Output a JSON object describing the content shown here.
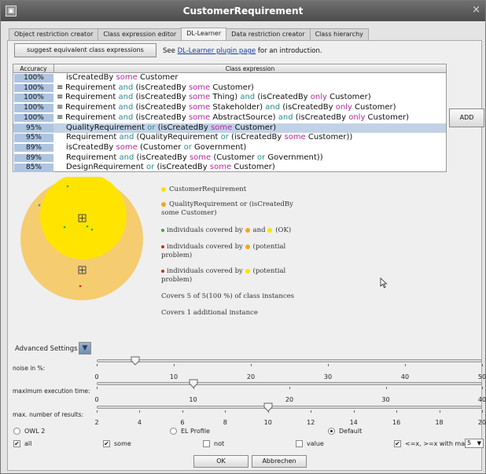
{
  "window": {
    "title": "CustomerRequirement",
    "close_glyph": "×"
  },
  "tabs": [
    {
      "label": "Object restriction creator"
    },
    {
      "label": "Class expression editor"
    },
    {
      "label": "DL-Learner"
    },
    {
      "label": "Data restriction creator"
    },
    {
      "label": "Class hierarchy"
    }
  ],
  "active_tab": "DL-Learner",
  "toolbar": {
    "suggest_label": "suggest equivalent class expressions",
    "intro_prefix": "See ",
    "intro_link": "DL-Learner plugin page",
    "intro_suffix": " for an introduction."
  },
  "table": {
    "headers": {
      "accuracy": "Accuracy",
      "expression": "Class expression"
    },
    "rows": [
      {
        "accuracy": "100%",
        "equivalent": false,
        "expr": [
          [
            "isCreatedBy ",
            ""
          ],
          [
            "some",
            "some"
          ],
          [
            " Customer",
            ""
          ]
        ]
      },
      {
        "accuracy": "100%",
        "equivalent": true,
        "expr": [
          [
            "Requirement ",
            ""
          ],
          [
            "and",
            "and"
          ],
          [
            " (isCreatedBy ",
            ""
          ],
          [
            "some",
            "some"
          ],
          [
            " Customer)",
            ""
          ]
        ]
      },
      {
        "accuracy": "100%",
        "equivalent": true,
        "expr": [
          [
            "Requirement ",
            ""
          ],
          [
            "and",
            "and"
          ],
          [
            " (isCreatedBy ",
            ""
          ],
          [
            "some",
            "some"
          ],
          [
            " Thing) ",
            ""
          ],
          [
            "and",
            "and"
          ],
          [
            " (isCreatedBy ",
            ""
          ],
          [
            "only",
            "only"
          ],
          [
            " Customer)",
            ""
          ]
        ]
      },
      {
        "accuracy": "100%",
        "equivalent": true,
        "expr": [
          [
            "Requirement ",
            ""
          ],
          [
            "and",
            "and"
          ],
          [
            " (isCreatedBy ",
            ""
          ],
          [
            "some",
            "some"
          ],
          [
            " Stakeholder) ",
            ""
          ],
          [
            "and",
            "and"
          ],
          [
            " (isCreatedBy ",
            ""
          ],
          [
            "only",
            "only"
          ],
          [
            " Customer)",
            ""
          ]
        ]
      },
      {
        "accuracy": "100%",
        "equivalent": true,
        "expr": [
          [
            "Requirement ",
            ""
          ],
          [
            "and",
            "and"
          ],
          [
            " (isCreatedBy ",
            ""
          ],
          [
            "some",
            "some"
          ],
          [
            " AbstractSource) ",
            ""
          ],
          [
            "and",
            "and"
          ],
          [
            " (isCreatedBy ",
            ""
          ],
          [
            "only",
            "only"
          ],
          [
            " Customer)",
            ""
          ]
        ]
      },
      {
        "accuracy": "95%",
        "equivalent": false,
        "selected": true,
        "expr": [
          [
            "QualityRequirement ",
            ""
          ],
          [
            "or",
            "or"
          ],
          [
            " (isCreatedBy ",
            ""
          ],
          [
            "some",
            "some"
          ],
          [
            " Customer)",
            ""
          ]
        ]
      },
      {
        "accuracy": "95%",
        "equivalent": false,
        "expr": [
          [
            "Requirement ",
            ""
          ],
          [
            "and",
            "and"
          ],
          [
            " (QualityRequirement ",
            ""
          ],
          [
            "or",
            "or"
          ],
          [
            " (isCreatedBy ",
            ""
          ],
          [
            "some",
            "some"
          ],
          [
            " Customer))",
            ""
          ]
        ]
      },
      {
        "accuracy": "89%",
        "equivalent": false,
        "expr": [
          [
            "isCreatedBy ",
            ""
          ],
          [
            "some",
            "some"
          ],
          [
            " (Customer ",
            ""
          ],
          [
            "or",
            "or"
          ],
          [
            " Government)",
            ""
          ]
        ]
      },
      {
        "accuracy": "89%",
        "equivalent": false,
        "expr": [
          [
            "Requirement ",
            ""
          ],
          [
            "and",
            "and"
          ],
          [
            " (isCreatedBy ",
            ""
          ],
          [
            "some",
            "some"
          ],
          [
            " (Customer ",
            ""
          ],
          [
            "or",
            "or"
          ],
          [
            " Government))",
            ""
          ]
        ]
      },
      {
        "accuracy": "85%",
        "equivalent": false,
        "expr": [
          [
            "DesignRequirement ",
            ""
          ],
          [
            "or",
            "or"
          ],
          [
            " (isCreatedBy ",
            ""
          ],
          [
            "some",
            "some"
          ],
          [
            " Customer)",
            ""
          ]
        ]
      }
    ],
    "equivalent_glyph": "≡"
  },
  "add_label": "ADD",
  "legend": {
    "class_label": "CustomerRequirement",
    "suggestion_label": "QualityRequirement or (isCreatedBy some Customer)",
    "covered_ok": "individuals covered by",
    "covered_ok_mid": "and",
    "covered_ok_suffix": "(OK)",
    "covered_potential_1": "individuals covered by",
    "covered_potential_1_suffix": "(potential problem)",
    "covered_potential_2": "individuals covered by",
    "covered_potential_2_suffix": "(potential problem)",
    "covers_line": "Covers 5 of 5(100 %) of class instances",
    "additional_line": "Covers 1 additional instance"
  },
  "colors": {
    "class_yellow": "#ffe100",
    "suggestion_orange": "#f3c14e",
    "ok_green": "#33aa33",
    "problem_red": "#dd2222"
  },
  "advanced": {
    "label": "Advanced Settings",
    "toggle_glyph": "▼"
  },
  "sliders": {
    "noise": {
      "label": "noise in %:",
      "value": 5,
      "ticks": [
        "0",
        "10",
        "20",
        "30",
        "40",
        "50"
      ]
    },
    "max_time": {
      "label": "maximum execution time:",
      "value": 10,
      "ticks": [
        "0",
        "10",
        "20",
        "30",
        "40"
      ]
    },
    "max_results": {
      "label": "max. number of results:",
      "value": 10,
      "ticks": [
        "2",
        "4",
        "6",
        "8",
        "10",
        "12",
        "14",
        "16",
        "18",
        "20"
      ]
    }
  },
  "profile": {
    "owl2": "OWL 2",
    "el": "EL Profile",
    "default": "Default",
    "selected": "Default"
  },
  "checks": {
    "all": {
      "label": "all",
      "checked": true
    },
    "some": {
      "label": "some",
      "checked": true
    },
    "not": {
      "label": "not",
      "checked": false
    },
    "value": {
      "label": "value",
      "checked": false
    },
    "card": {
      "label": "<=x, >=x with max.:",
      "checked": true,
      "max": "5"
    }
  },
  "footer": {
    "ok": "OK",
    "cancel": "Abbrechen"
  }
}
